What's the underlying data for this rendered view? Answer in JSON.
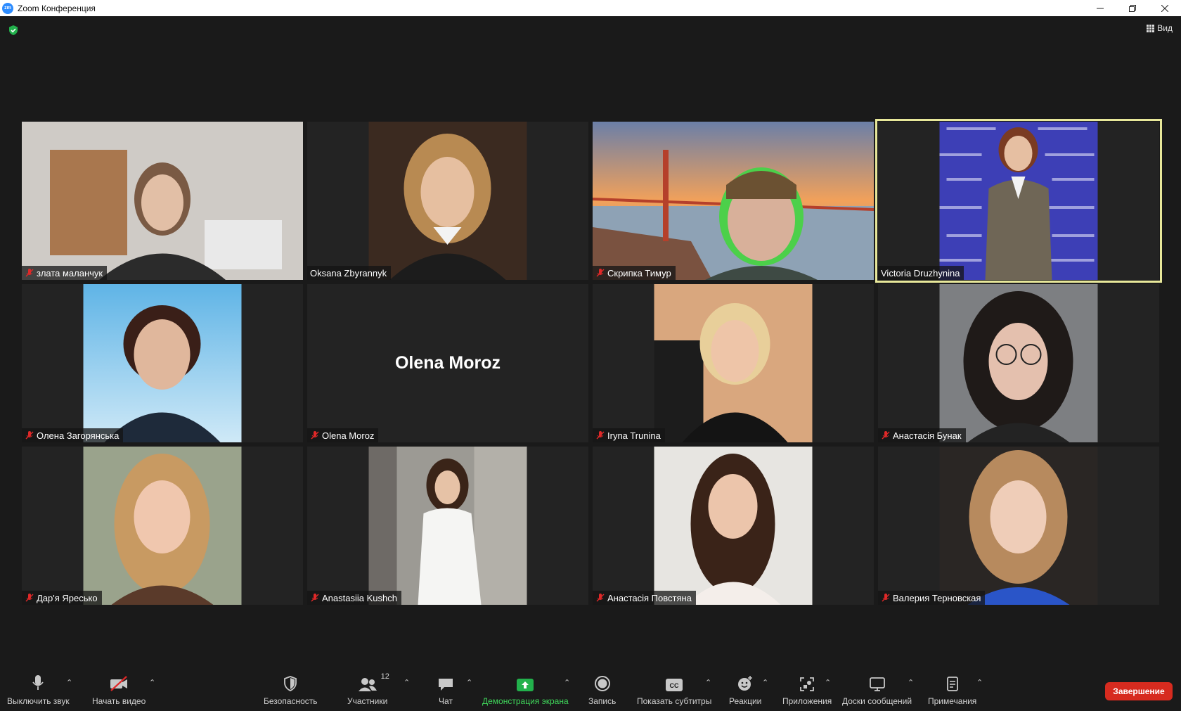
{
  "window": {
    "logo_text": "zm",
    "title": "Zoom Конференция"
  },
  "top_bar": {
    "view_label": "Вид"
  },
  "participants": [
    {
      "name": "злата маланчук",
      "muted": true,
      "video": true,
      "active": false
    },
    {
      "name": "Oksana Zbyrannyk",
      "muted": false,
      "video": true,
      "active": false
    },
    {
      "name": "Скрипка Тимур",
      "muted": true,
      "video": true,
      "active": false
    },
    {
      "name": "Victoria Druzhynina",
      "muted": false,
      "video": true,
      "active": true
    },
    {
      "name": "Олена Загорянська",
      "muted": true,
      "video": true,
      "active": false
    },
    {
      "name": "Olena Moroz",
      "muted": true,
      "video": false,
      "active": false,
      "placeholder_name": "Olena Moroz"
    },
    {
      "name": "Iryna Trunina",
      "muted": true,
      "video": true,
      "active": false
    },
    {
      "name": "Анастасія Бунак",
      "muted": true,
      "video": true,
      "active": false
    },
    {
      "name": "Дар'я Яресько",
      "muted": true,
      "video": true,
      "active": false
    },
    {
      "name": "Anastasiia Kushch",
      "muted": true,
      "video": true,
      "active": false
    },
    {
      "name": "Анастасія Повстяна",
      "muted": true,
      "video": true,
      "active": false
    },
    {
      "name": "Валерия Терновская",
      "muted": true,
      "video": true,
      "active": false
    }
  ],
  "toolbar": {
    "mute": "Выключить звук",
    "video": "Начать видео",
    "security": "Безопасность",
    "participants": "Участники",
    "participants_count": "12",
    "chat": "Чат",
    "share": "Демонстрация экрана",
    "record": "Запись",
    "captions": "Показать субтитры",
    "captions_icon_text": "CC",
    "reactions": "Реакции",
    "apps": "Приложения",
    "whiteboards": "Доски сообщений",
    "notes": "Примечания",
    "end": "Завершение"
  },
  "colors": {
    "background": "#1a1a1a",
    "tile": "#232323",
    "active_speaker_border": "#e8e89a",
    "share_green": "#3fd55a",
    "end_red": "#d72b1f"
  }
}
